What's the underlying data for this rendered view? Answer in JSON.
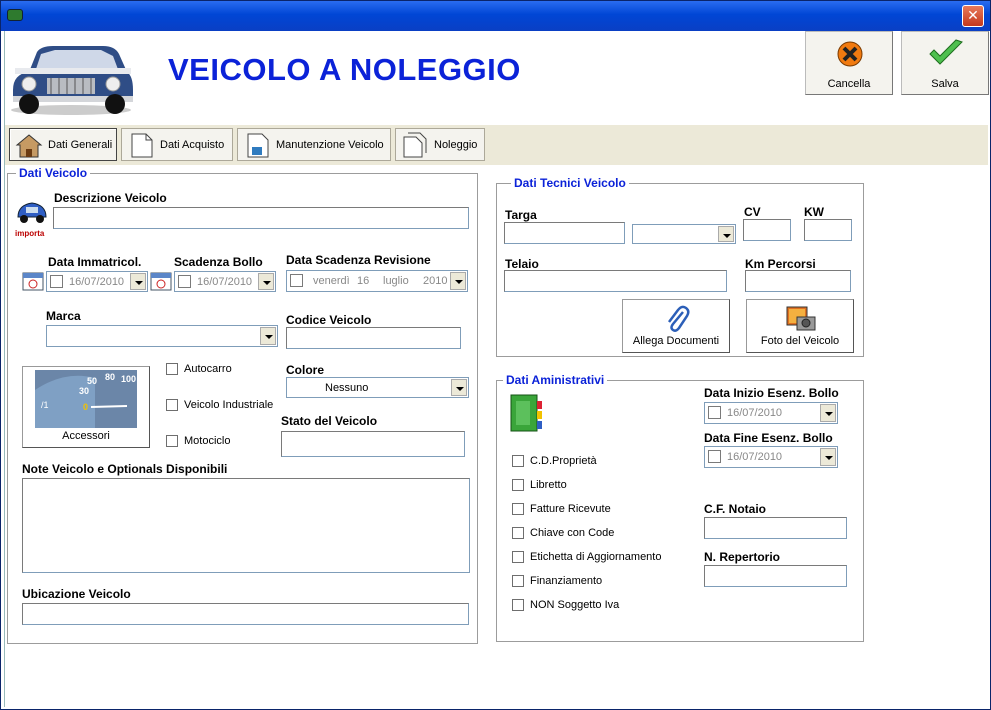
{
  "window": {
    "title": ""
  },
  "header": {
    "title": "VEICOLO A NOLEGGIO",
    "cancel_label": "Cancella",
    "save_label": "Salva"
  },
  "tabs": [
    {
      "label": "Dati Generali"
    },
    {
      "label": "Dati Acquisto"
    },
    {
      "label": "Manutenzione Veicolo"
    },
    {
      "label": "Noleggio"
    }
  ],
  "veicolo": {
    "legend": "Dati Veicolo",
    "import_label": "importa",
    "descrizione_label": "Descrizione Veicolo",
    "immatricol_label": "Data Immatricol.",
    "immatricol_value": "16/07/2010",
    "bollo_label": "Scadenza Bollo",
    "bollo_value": "16/07/2010",
    "revisione_label": "Data Scadenza Revisione",
    "revisione_day": "venerdì",
    "revisione_num": "16",
    "revisione_month": "luglio",
    "revisione_year": "2010",
    "marca_label": "Marca",
    "codice_label": "Codice Veicolo",
    "accessori_label": "Accessori",
    "autocarro_label": "Autocarro",
    "industriale_label": "Veicolo Industriale",
    "motociclo_label": "Motociclo",
    "colore_label": "Colore",
    "colore_value": "Nessuno",
    "stato_label": "Stato del Veicolo",
    "note_label": "Note Veicolo e Optionals Disponibili",
    "ubicazione_label": "Ubicazione Veicolo"
  },
  "tecnici": {
    "legend": "Dati Tecnici Veicolo",
    "targa_label": "Targa",
    "cv_label": "CV",
    "kw_label": "KW",
    "telaio_label": "Telaio",
    "km_label": "Km Percorsi",
    "allega_label": "Allega Documenti",
    "foto_label": "Foto del Veicolo"
  },
  "amministrativi": {
    "legend": "Dati Aministrativi",
    "inizio_label": "Data Inizio Esenz. Bollo",
    "inizio_value": "16/07/2010",
    "fine_label": "Data Fine Esenz. Bollo",
    "fine_value": "16/07/2010",
    "checks": [
      "C.D.Proprietà",
      "Libretto",
      "Fatture Ricevute",
      "Chiave con Code",
      "Etichetta di Aggiornamento",
      "Finanziamento",
      "NON Soggetto Iva"
    ],
    "notaio_label": "C.F. Notaio",
    "repertorio_label": "N. Repertorio"
  },
  "colors": {
    "title_blue": "#0b22d8",
    "titlebar": "#0046d5",
    "tab_bg": "#ece9d8"
  }
}
